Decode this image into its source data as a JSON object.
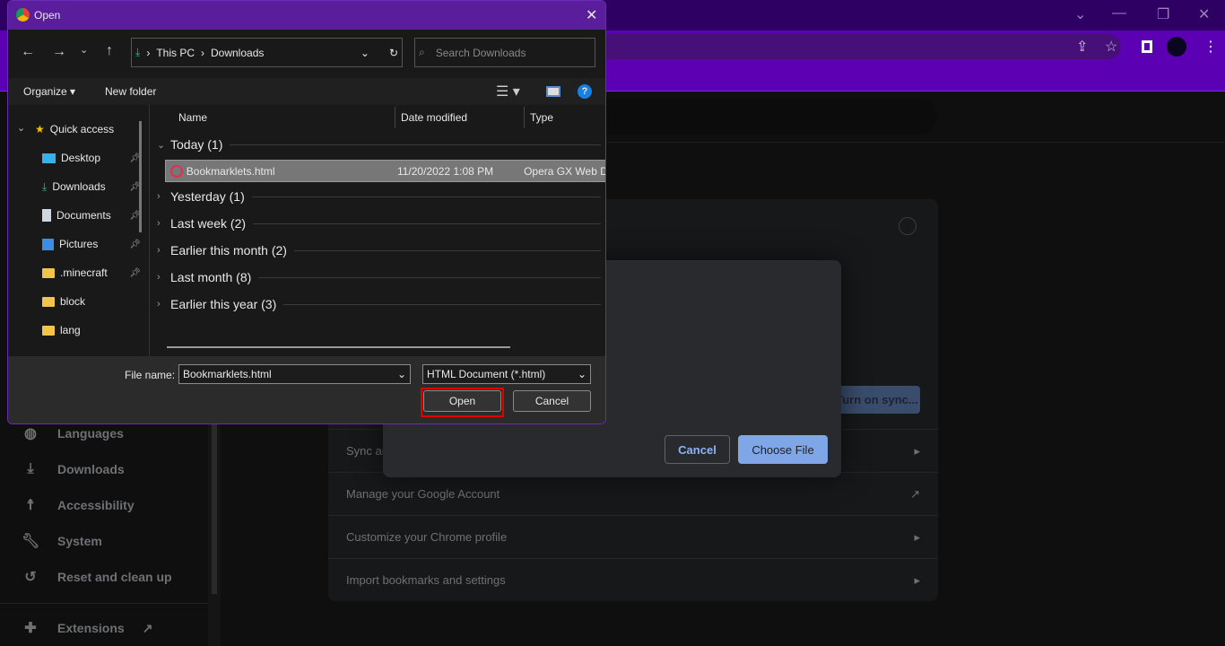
{
  "browser": {
    "sidebar": [
      {
        "label": "Languages",
        "icon": "globe-icon"
      },
      {
        "label": "Downloads",
        "icon": "download-icon"
      },
      {
        "label": "Accessibility",
        "icon": "accessibility-icon"
      },
      {
        "label": "System",
        "icon": "wrench-icon"
      },
      {
        "label": "Reset and clean up",
        "icon": "history-icon"
      }
    ],
    "extensions": "Extensions",
    "rows": [
      "Sync and Google services",
      "Manage your Google Account",
      "Customize your Chrome profile",
      "Import bookmarks and settings"
    ],
    "sync_button": "Turn on sync...",
    "modal": {
      "cancel": "Cancel",
      "choose": "Choose File"
    }
  },
  "dialog": {
    "title": "Open",
    "breadcrumb": [
      "This PC",
      "Downloads"
    ],
    "search_placeholder": "Search Downloads",
    "toolbar": {
      "organize": "Organize",
      "new_folder": "New folder"
    },
    "nav": {
      "quick_access": "Quick access",
      "items": [
        {
          "label": "Desktop",
          "pinned": true
        },
        {
          "label": "Downloads",
          "pinned": true
        },
        {
          "label": "Documents",
          "pinned": true
        },
        {
          "label": "Pictures",
          "pinned": true
        },
        {
          "label": ".minecraft",
          "pinned": true
        },
        {
          "label": "block",
          "pinned": false
        },
        {
          "label": "lang",
          "pinned": false
        }
      ]
    },
    "columns": [
      "Name",
      "Date modified",
      "Type"
    ],
    "groups": [
      {
        "label": "Today (1)",
        "expanded": true
      },
      {
        "label": "Yesterday (1)"
      },
      {
        "label": "Last week (2)"
      },
      {
        "label": "Earlier this month (2)"
      },
      {
        "label": "Last month (8)"
      },
      {
        "label": "Earlier this year (3)"
      }
    ],
    "file": {
      "name": "Bookmarklets.html",
      "date": "11/20/2022 1:08 PM",
      "type": "Opera GX Web D"
    },
    "filename_label": "File name:",
    "filename_value": "Bookmarklets.html",
    "filetype": "HTML Document (*.html)",
    "open": "Open",
    "cancel": "Cancel"
  },
  "colors": {
    "accent": "#5c00b3",
    "highlight": "#e00000",
    "choose_file": "#7fa6e6"
  }
}
